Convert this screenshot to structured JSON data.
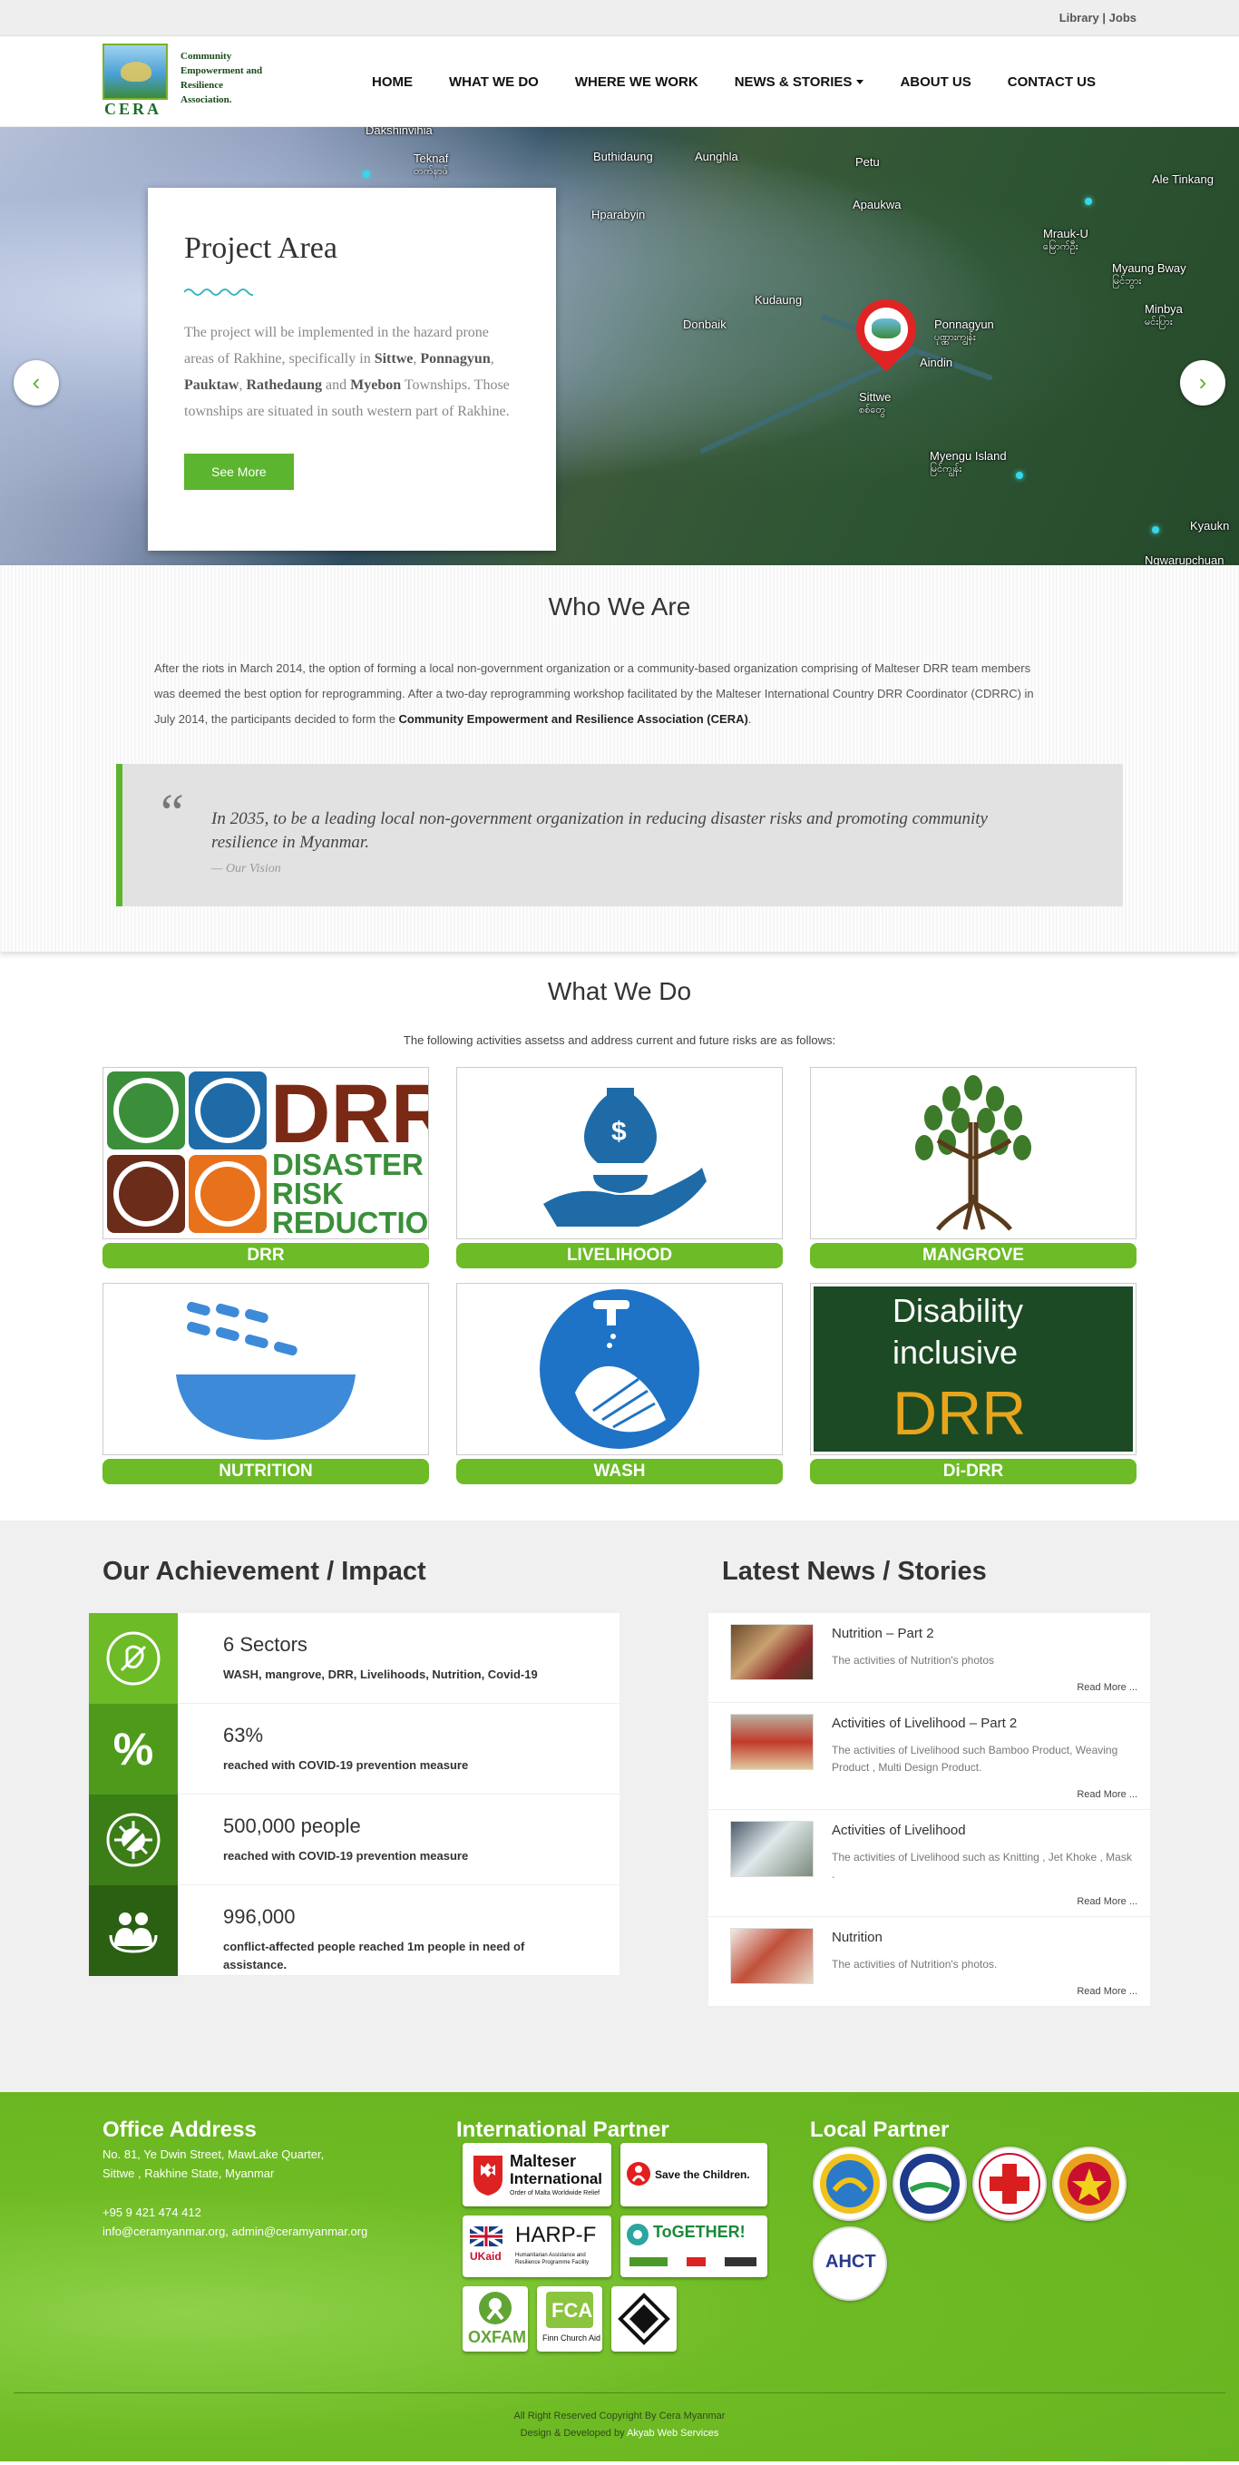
{
  "topbar": {
    "library": "Library",
    "separator": "|",
    "jobs": "Jobs"
  },
  "logo": {
    "abbr": "CERA",
    "full": "Community Empowerment and Resilience Association."
  },
  "nav": {
    "home": "HOME",
    "what": "WHAT WE DO",
    "where": "WHERE WE WORK",
    "news": "NEWS & STORIES",
    "about": "ABOUT US",
    "contact": "CONTACT US"
  },
  "hero": {
    "title": "Project Area",
    "text_pre": "The project will be implemented in the hazard prone areas of Rakhine, specifically in ",
    "places": [
      "Sittwe",
      "Ponnagyun",
      "Pauktaw",
      "Rathedaung",
      "Myebon"
    ],
    "sep1": ", ",
    "sep2": ", ",
    "sep3": ", ",
    "sep4": " and ",
    "text_post": " Townships. Those townships are situated in south western part of Rakhine.",
    "button": "See More",
    "map_labels": [
      "Dakshinvihia",
      "Teknaf",
      "Buthidaung",
      "Aunghla",
      "Petu",
      "Ale Tinkang",
      "Hparabyin",
      "Apaukwa",
      "Mrauk-U",
      "Myaung Bway",
      "Kudaung",
      "Donbaik",
      "Ponnagyun",
      "Minbya",
      "Aindin",
      "Sittwe",
      "Myengu Island",
      "Kyaukn",
      "Ngwarupchuan"
    ],
    "map_labels_mm": [
      "တက်နာဖ်",
      "ဝိမ္မပူ",
      "မြောက်ဦး",
      "မြင်ဘွား",
      "ပုဏ္ဏားကျွန်း",
      "မင်းပြား",
      "စစ်တွေ",
      "မြင်ကျွန်း"
    ],
    "prev_icon": "chevron-left",
    "next_icon": "chevron-right"
  },
  "who": {
    "title": "Who We Are",
    "intro": "After the riots in March 2014, the option of forming a local non-government organization or a community-based organization comprising of Malteser DRR team members was deemed the best option for reprogramming. After a two-day reprogramming workshop facilitated by the Malteser International Country DRR Coordinator (CDRRC) in July 2014, the participants decided to form the ",
    "intro_bold": "Community Empowerment and Resilience Association (CERA)",
    "intro_end": ".",
    "quote": "In 2035, to be a leading local non-government organization in reducing disaster risks and promoting community resilience in Myanmar.",
    "cite": "— Our Vision",
    "quote_mark": "“"
  },
  "what": {
    "title": "What We Do",
    "subtitle": "The following activities assetss and address current and future risks are as follows:",
    "cards": [
      {
        "label": "DRR",
        "drr_big": "DRR",
        "drr_lines": [
          "DISASTER",
          "RISK",
          "REDUCTION"
        ]
      },
      {
        "label": "LIVELIHOOD",
        "bag_symbol": "$"
      },
      {
        "label": "MANGROVE"
      },
      {
        "label": "NUTRITION"
      },
      {
        "label": "WASH"
      },
      {
        "label": "Di-DRR",
        "lines": [
          "Disability",
          "inclusive",
          "DRR"
        ]
      }
    ]
  },
  "achievement": {
    "title": "Our Achievement / Impact",
    "rows": [
      {
        "big": "6 Sectors",
        "small": "WASH, mangrove, DRR, Livelihoods, Nutrition, Covid-19",
        "icon": "percent-leaf-icon",
        "color": "#6cbb27"
      },
      {
        "big": "63%",
        "small": "reached with COVID-19 prevention measure",
        "icon": "percent-icon",
        "color": "#4e9b1c"
      },
      {
        "big": "500,000 people",
        "small": "reached with COVID-19 prevention measure",
        "icon": "virus-icon",
        "color": "#3b7d17"
      },
      {
        "big": "996,000",
        "small": "conflict-affected people reached 1m people in need of assistance.",
        "icon": "people-icon",
        "color": "#2b5f12"
      }
    ],
    "percent_glyph": "%"
  },
  "news": {
    "title": "Latest News / Stories",
    "items": [
      {
        "title": "Nutrition – Part 2",
        "desc": "The activities of Nutrition's photos",
        "more": "Read More ..."
      },
      {
        "title": "Activities of Livelihood – Part 2",
        "desc": "The activities of Livelihood such Bamboo Product, Weaving Product , Multi Design Product.",
        "more": "Read More ..."
      },
      {
        "title": "Activities of Livelihood",
        "desc": "The activities of Livelihood such as Knitting , Jet Khoke , Mask .",
        "more": "Read More ..."
      },
      {
        "title": "Nutrition",
        "desc": "The activities of Nutrition's photos.",
        "more": "Read More ..."
      }
    ]
  },
  "footer": {
    "office_title": "Office Address",
    "addr1": "No. 81, Ye Dwin Street, MawLake Quarter,",
    "addr2": "Sittwe , Rakhine State, Myanmar",
    "phone": "+95 9 421 474 412",
    "emails": "info@ceramyanmar.org, admin@ceramyanmar.org",
    "intl_title": "International Partner",
    "partners": {
      "malteser1": "Malteser",
      "malteser2": "International",
      "malteser3": "Order of Malta Worldwide Relief",
      "save": "Save the Children.",
      "ukaid": "UKaid",
      "harp": "HARP-F",
      "harp_sub": "Humanitarian Assistance and Resilience Programme Facility",
      "together": "ToGETHER!",
      "oxfam": "OXFAM",
      "fca": "FCA",
      "fca_sub": "Finn Church Aid"
    },
    "local_title": "Local Partner",
    "ahct": "AHCT",
    "copyright": "All Right Reserved Copyright By Cera Myanmar",
    "design_pre": "Design & Developed by ",
    "design_by": "Akyab Web Services"
  },
  "colors": {
    "accent": "#5bb52e",
    "label_green": "#6cbb27",
    "footer_green": "#64b21f"
  }
}
